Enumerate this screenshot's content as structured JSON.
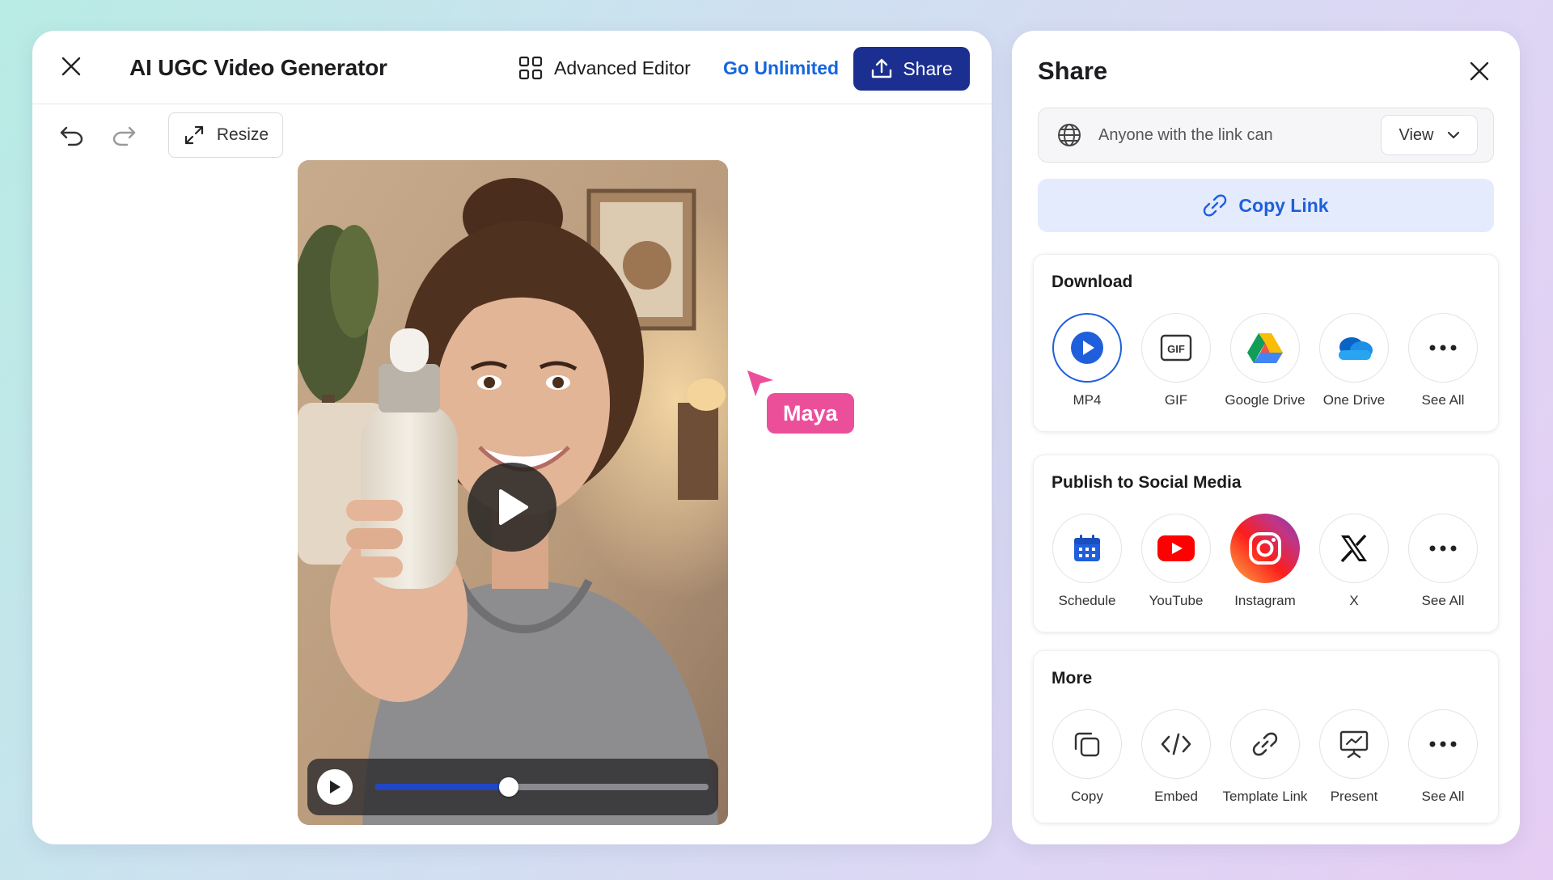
{
  "editor": {
    "title": "AI UGC Video Generator",
    "advanced_editor_label": "Advanced Editor",
    "go_unlimited_label": "Go Unlimited",
    "share_label": "Share",
    "resize_label": "Resize",
    "progress_fraction": 0.4,
    "collaborator_name": "Maya",
    "colors": {
      "primary": "#1a2f8f",
      "link": "#1565e0",
      "collaborator": "#ec4f9a"
    }
  },
  "share": {
    "title": "Share",
    "access_text": "Anyone with the link can",
    "access_value": "View",
    "copy_link_label": "Copy Link",
    "sections": [
      {
        "title": "Download",
        "items": [
          {
            "label": "MP4",
            "icon": "mp4-play-icon",
            "selected": true
          },
          {
            "label": "GIF",
            "icon": "gif-icon"
          },
          {
            "label": "Google Drive",
            "icon": "google-drive-icon"
          },
          {
            "label": "One Drive",
            "icon": "onedrive-icon"
          },
          {
            "label": "See All",
            "icon": "more-icon"
          }
        ]
      },
      {
        "title": "Publish to Social Media",
        "items": [
          {
            "label": "Schedule",
            "icon": "calendar-icon"
          },
          {
            "label": "YouTube",
            "icon": "youtube-icon"
          },
          {
            "label": "Instagram",
            "icon": "instagram-icon"
          },
          {
            "label": "X",
            "icon": "x-icon"
          },
          {
            "label": "See All",
            "icon": "more-icon"
          }
        ]
      },
      {
        "title": "More",
        "items": [
          {
            "label": "Copy",
            "icon": "copy-icon"
          },
          {
            "label": "Embed",
            "icon": "embed-icon"
          },
          {
            "label": "Template Link",
            "icon": "template-link-icon"
          },
          {
            "label": "Present",
            "icon": "present-icon"
          },
          {
            "label": "See All",
            "icon": "more-icon"
          }
        ]
      }
    ]
  }
}
